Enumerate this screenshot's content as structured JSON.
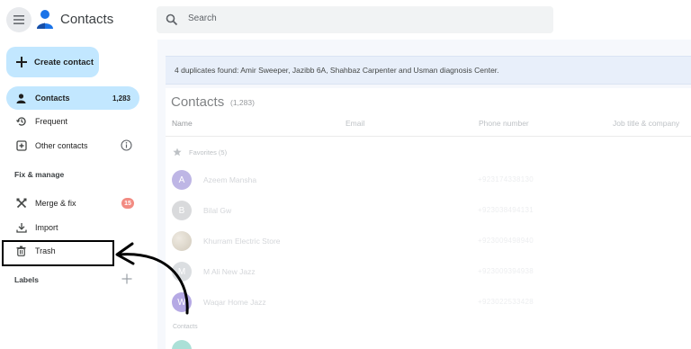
{
  "header": {
    "title": "Contacts",
    "search_placeholder": "Search"
  },
  "sidebar": {
    "create_label": "Create contact",
    "items": [
      {
        "label": "Contacts",
        "count": "1,283",
        "icon": "person-icon",
        "active": true
      },
      {
        "label": "Frequent",
        "icon": "history-icon"
      },
      {
        "label": "Other contacts",
        "icon": "add-box-icon"
      }
    ],
    "fix_manage_label": "Fix & manage",
    "manage_items": [
      {
        "label": "Merge & fix",
        "badge": "15",
        "icon": "merge-icon"
      },
      {
        "label": "Import",
        "icon": "download-icon"
      },
      {
        "label": "Trash",
        "icon": "trash-icon"
      }
    ],
    "labels_label": "Labels"
  },
  "main": {
    "banner": "4 duplicates found: Amir Sweeper, Jazibb 6A, Shahbaz Carpenter and Usman diagnosis Center.",
    "list_title": "Contacts",
    "list_count": "(1,283)",
    "columns": [
      "Name",
      "Email",
      "Phone number",
      "Job title & company"
    ],
    "favorites_label": "Favorites (5)",
    "favorites": [
      {
        "initial": "A",
        "name": "Azeem Mansha",
        "phone": "+923174338130",
        "color": "#9c8fd8"
      },
      {
        "initial": "B",
        "name": "Bilal Gw",
        "phone": "+923038494131",
        "color": "#c5c7c9"
      },
      {
        "initial": "",
        "name": "Khurram Electric Store",
        "phone": "+923009498940",
        "color": "#c9c0b0"
      },
      {
        "initial": "M",
        "name": "M Ali New Jazz",
        "phone": "+923009394938",
        "color": "#c8ccd1"
      },
      {
        "initial": "W",
        "name": "Waqar Home Jazz",
        "phone": "+923022533428",
        "color": "#8e7bd6"
      }
    ],
    "contacts_section_label": "Contacts"
  },
  "colors": {
    "accent": "#c2e7ff",
    "annotation": "#000000",
    "badge": "#f28b82"
  }
}
